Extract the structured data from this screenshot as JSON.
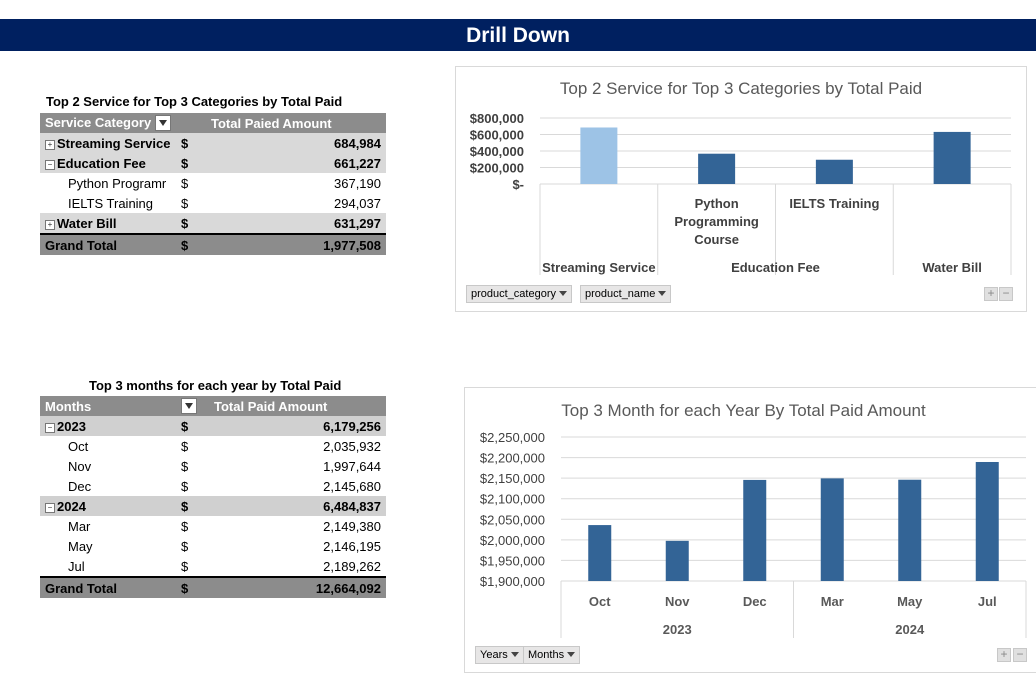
{
  "banner": {
    "title": "Drill Down"
  },
  "pivot1": {
    "title": "Top 2 Service for Top 3 Categories by  Total Paid",
    "header": {
      "col1": "Service Category",
      "col2": "Total Paied Amount"
    },
    "rows": [
      {
        "label": "Streaming Service",
        "currency": "$",
        "value": "684,984",
        "level": "group",
        "toggle": "+"
      },
      {
        "label": "Education Fee",
        "currency": "$",
        "value": "661,227",
        "level": "group",
        "toggle": "−"
      },
      {
        "label": "Python Programr",
        "currency": "$",
        "value": "367,190",
        "level": "child"
      },
      {
        "label": "IELTS Training",
        "currency": "$",
        "value": "294,037",
        "level": "child"
      },
      {
        "label": "Water Bill",
        "currency": "$",
        "value": "631,297",
        "level": "group",
        "toggle": "+"
      }
    ],
    "total": {
      "label": "Grand Total",
      "currency": "$",
      "value": "1,977,508"
    }
  },
  "pivot2": {
    "title": "Top 3 months for each year by Total Paid",
    "header": {
      "col1": "Months",
      "col2": "Total Paid Amount"
    },
    "rows": [
      {
        "label": "2023",
        "currency": "$",
        "value": "6,179,256",
        "level": "group",
        "toggle": "−"
      },
      {
        "label": "Oct",
        "currency": "$",
        "value": "2,035,932",
        "level": "child"
      },
      {
        "label": "Nov",
        "currency": "$",
        "value": "1,997,644",
        "level": "child"
      },
      {
        "label": "Dec",
        "currency": "$",
        "value": "2,145,680",
        "level": "child"
      },
      {
        "label": "2024",
        "currency": "$",
        "value": "6,484,837",
        "level": "group",
        "toggle": "−"
      },
      {
        "label": "Mar",
        "currency": "$",
        "value": "2,149,380",
        "level": "child"
      },
      {
        "label": "May",
        "currency": "$",
        "value": "2,146,195",
        "level": "child"
      },
      {
        "label": "Jul",
        "currency": "$",
        "value": "2,189,262",
        "level": "child"
      }
    ],
    "total": {
      "label": "Grand Total",
      "currency": "$",
      "value": "12,664,092"
    }
  },
  "chart_data": [
    {
      "type": "bar",
      "title": "Top 2 Service for Top 3 Categories by  Total Paid",
      "categories": [
        {
          "label": "Streaming Service",
          "value": 684984,
          "color": "#9dc3e6"
        },
        {
          "label": "Python Programming Course",
          "value": 367190,
          "color": "#336496",
          "group": "Education Fee"
        },
        {
          "label": "IELTS Training",
          "value": 294037,
          "color": "#336496",
          "group": "Education Fee"
        },
        {
          "label": "Water Bill",
          "value": 631297,
          "color": "#336496"
        }
      ],
      "category_labels": [
        {
          "lines": []
        },
        {
          "lines": [
            "Python",
            "Programming",
            "Course"
          ]
        },
        {
          "lines": [
            "IELTS Training"
          ]
        },
        {
          "lines": []
        }
      ],
      "outer_labels": [
        "Streaming Service",
        "Education Fee",
        "Water Bill"
      ],
      "ylim": [
        0,
        800000
      ],
      "yticks": [
        "$800,000",
        "$600,000",
        "$400,000",
        "$200,000",
        "$-"
      ],
      "grid": true,
      "field_buttons": [
        "product_category",
        "product_name"
      ]
    },
    {
      "type": "bar",
      "title": "Top 3 Month for each Year By Total Paid Amount",
      "categories": [
        {
          "label": "Oct",
          "value": 2035932,
          "group": "2023"
        },
        {
          "label": "Nov",
          "value": 1997644,
          "group": "2023"
        },
        {
          "label": "Dec",
          "value": 2145680,
          "group": "2023"
        },
        {
          "label": "Mar",
          "value": 2149380,
          "group": "2024"
        },
        {
          "label": "May",
          "value": 2146195,
          "group": "2024"
        },
        {
          "label": "Jul",
          "value": 2189262,
          "group": "2024"
        }
      ],
      "groups": [
        "2023",
        "2024"
      ],
      "ylim": [
        1900000,
        2250000
      ],
      "yticks": [
        "$2,250,000",
        "$2,200,000",
        "$2,150,000",
        "$2,100,000",
        "$2,050,000",
        "$2,000,000",
        "$1,950,000",
        "$1,900,000"
      ],
      "color": "#336496",
      "grid": true,
      "field_buttons": [
        "Years",
        "Months"
      ]
    }
  ]
}
